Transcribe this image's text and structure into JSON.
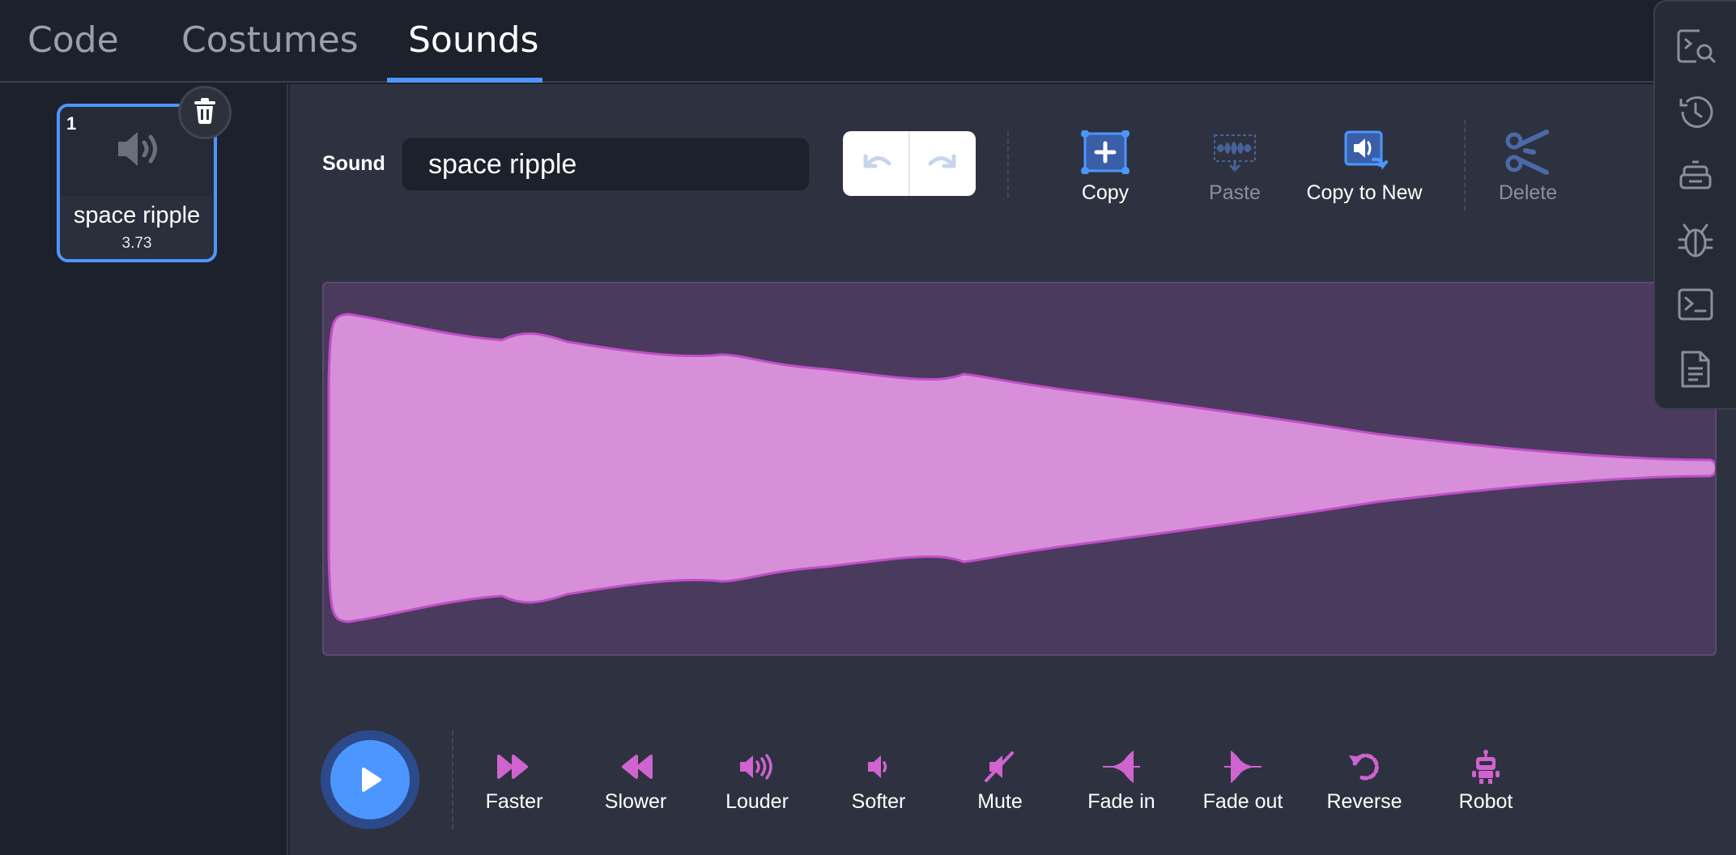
{
  "tabs": [
    {
      "label": "Code"
    },
    {
      "label": "Costumes"
    },
    {
      "label": "Sounds"
    }
  ],
  "sound_list": {
    "items": [
      {
        "index": "1",
        "name": "space ripple",
        "duration": "3.73"
      }
    ]
  },
  "editor": {
    "sound_label": "Sound",
    "sound_name_value": "space ripple",
    "tools": [
      {
        "label": "Copy"
      },
      {
        "label": "Paste"
      },
      {
        "label": "Copy to New"
      },
      {
        "label": "Delete"
      }
    ],
    "effects": [
      {
        "label": "Faster"
      },
      {
        "label": "Slower"
      },
      {
        "label": "Louder"
      },
      {
        "label": "Softer"
      },
      {
        "label": "Mute"
      },
      {
        "label": "Fade in"
      },
      {
        "label": "Fade out"
      },
      {
        "label": "Reverse"
      },
      {
        "label": "Robot"
      }
    ]
  },
  "colors": {
    "accent": "#4c97ff",
    "waveform_fill": "#d78fd9",
    "waveform_stroke": "#c04ec7",
    "effect_icon": "#cf63cf"
  },
  "icons": {
    "dock": [
      "code-search-icon",
      "history-icon",
      "addon-robot-icon",
      "debug-bug-icon",
      "terminal-icon",
      "document-icon"
    ]
  }
}
